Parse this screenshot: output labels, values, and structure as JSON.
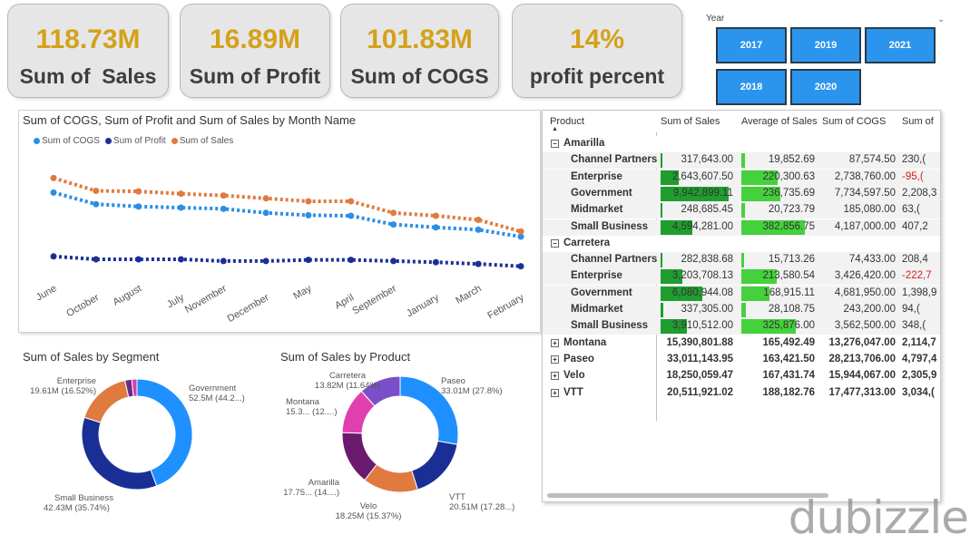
{
  "kpis": [
    {
      "value": "118.73M",
      "label": "Sum of  Sales"
    },
    {
      "value": "16.89M",
      "label": "Sum of Profit"
    },
    {
      "value": "101.83M",
      "label": "Sum of COGS"
    },
    {
      "value": "14%",
      "label": "profit percent"
    }
  ],
  "slicer": {
    "title": "Year",
    "chevron": "chevron-down-icon",
    "years": [
      "2017",
      "2019",
      "2021",
      "2018",
      "2020"
    ]
  },
  "line_chart": {
    "title": "Sum of COGS, Sum of Profit and Sum of Sales by Month Name",
    "legend": [
      "Sum of COGS",
      "Sum of Profit",
      "Sum of  Sales"
    ]
  },
  "segment_chart": {
    "title": "Sum of Sales by Segment",
    "labels": [
      {
        "line1": "Enterprise",
        "line2": "19.61M (16.52%)"
      },
      {
        "line1": "Government",
        "line2": "52.5M (44.2...)"
      },
      {
        "line1": "Small Business",
        "line2": "42.43M (35.74%)"
      }
    ]
  },
  "product_chart": {
    "title": "Sum of Sales by Product",
    "labels": [
      {
        "line1": "Carretera",
        "line2": "13.82M (11.64%)"
      },
      {
        "line1": "Paseo",
        "line2": "33.01M (27.8%)"
      },
      {
        "line1": "Montana",
        "line2": "15.3... (12....)"
      },
      {
        "line1": "Amarilla",
        "line2": "17.75... (14....)"
      },
      {
        "line1": "VTT",
        "line2": "20.51M (17.28...)"
      },
      {
        "line1": "Velo",
        "line2": "18.25M (15.37%)"
      }
    ]
  },
  "table": {
    "headers": [
      "Product",
      "Sum of Sales",
      "Average of Sales",
      "Sum of COGS",
      "Sum of"
    ],
    "rows": [
      {
        "level": 0,
        "expand": "−",
        "label": "Amarilla",
        "cells": [
          "",
          "",
          "",
          ""
        ]
      },
      {
        "level": 1,
        "label": "Channel Partners",
        "cells": [
          "317,643.00",
          "19,852.69",
          "87,574.50",
          "230,("
        ],
        "neg": false
      },
      {
        "level": 1,
        "label": "Enterprise",
        "cells": [
          "2,643,607.50",
          "220,300.63",
          "2,738,760.00",
          "-95,("
        ],
        "neg": true
      },
      {
        "level": 1,
        "label": "Government",
        "cells": [
          "9,942,899.11",
          "236,735.69",
          "7,734,597.50",
          "2,208,3"
        ],
        "neg": false
      },
      {
        "level": 1,
        "label": "Midmarket",
        "cells": [
          "248,685.45",
          "20,723.79",
          "185,080.00",
          "63,("
        ],
        "neg": false
      },
      {
        "level": 1,
        "label": "Small Business",
        "cells": [
          "4,594,281.00",
          "382,856.75",
          "4,187,000.00",
          "407,2"
        ],
        "neg": false
      },
      {
        "level": 0,
        "expand": "−",
        "label": "Carretera",
        "cells": [
          "",
          "",
          "",
          ""
        ]
      },
      {
        "level": 1,
        "label": "Channel Partners",
        "cells": [
          "282,838.68",
          "15,713.26",
          "74,433.00",
          "208,4"
        ],
        "neg": false
      },
      {
        "level": 1,
        "label": "Enterprise",
        "cells": [
          "3,203,708.13",
          "213,580.54",
          "3,426,420.00",
          "-222,7"
        ],
        "neg": true
      },
      {
        "level": 1,
        "label": "Government",
        "cells": [
          "6,080,944.08",
          "168,915.11",
          "4,681,950.00",
          "1,398,9"
        ],
        "neg": false
      },
      {
        "level": 1,
        "label": "Midmarket",
        "cells": [
          "337,305.00",
          "28,108.75",
          "243,200.00",
          "94,("
        ],
        "neg": false
      },
      {
        "level": 1,
        "label": "Small Business",
        "cells": [
          "3,910,512.00",
          "325,876.00",
          "3,562,500.00",
          "348,("
        ],
        "neg": false
      },
      {
        "level": 0,
        "expand": "+",
        "label": "Montana",
        "cells": [
          "15,390,801.88",
          "165,492.49",
          "13,276,047.00",
          "2,114,7"
        ]
      },
      {
        "level": 0,
        "expand": "+",
        "label": "Paseo",
        "cells": [
          "33,011,143.95",
          "163,421.50",
          "28,213,706.00",
          "4,797,4"
        ]
      },
      {
        "level": 0,
        "expand": "+",
        "label": "Velo",
        "cells": [
          "18,250,059.47",
          "167,431.74",
          "15,944,067.00",
          "2,305,9"
        ]
      },
      {
        "level": 0,
        "expand": "+",
        "label": "VTT",
        "cells": [
          "20,511,921.02",
          "188,182.76",
          "17,477,313.00",
          "3,034,("
        ]
      }
    ]
  },
  "watermark": "dubizzle",
  "colors": {
    "kpi_value": "#d4a11a",
    "cogs": "#2b8ee6",
    "profit": "#1a2f96",
    "sales": "#e07a3f",
    "bar_dark": "#1f9e2e",
    "bar_light": "#44d13c",
    "negative": "#d02020",
    "slicer_button": "#2b95ee"
  },
  "chart_data": [
    {
      "type": "line",
      "title": "Sum of COGS, Sum of Profit and Sum of Sales by Month Name",
      "x": [
        "June",
        "October",
        "August",
        "July",
        "November",
        "December",
        "May",
        "April",
        "September",
        "January",
        "March",
        "February"
      ],
      "series": [
        {
          "name": "Sum of COGS",
          "values": [
            14.0,
            12.0,
            11.6,
            11.4,
            11.2,
            10.5,
            10.1,
            10.0,
            8.5,
            8.0,
            7.6,
            6.4
          ]
        },
        {
          "name": "Sum of Profit",
          "values": [
            3.0,
            2.5,
            2.5,
            2.5,
            2.2,
            2.2,
            2.4,
            2.4,
            2.2,
            2.0,
            1.7,
            1.3
          ]
        },
        {
          "name": "Sum of  Sales",
          "values": [
            16.5,
            14.3,
            14.2,
            13.8,
            13.5,
            13.0,
            12.5,
            12.5,
            10.5,
            10.0,
            9.3,
            7.3
          ]
        }
      ],
      "ylim": [
        0,
        20
      ],
      "grid": false,
      "legend_position": "top-left"
    },
    {
      "type": "pie",
      "title": "Sum of Sales by Segment",
      "categories": [
        "Government",
        "Small Business",
        "Enterprise",
        "Midmarket",
        "Channel Partners"
      ],
      "values": [
        52.5,
        42.43,
        19.61,
        2.4,
        1.8
      ],
      "colors": [
        "#1e90ff",
        "#1a2f96",
        "#e07a3f",
        "#6b2a8a",
        "#d93fa8"
      ]
    },
    {
      "type": "pie",
      "title": "Sum of Sales by Product",
      "categories": [
        "Paseo",
        "VTT",
        "Velo",
        "Amarilla",
        "Montana",
        "Carretera"
      ],
      "values": [
        33.01,
        20.51,
        18.25,
        17.75,
        15.3,
        13.82
      ],
      "colors": [
        "#1e90ff",
        "#1a2f96",
        "#e07a3f",
        "#6b1a6e",
        "#e03fb0",
        "#7a4fc9"
      ]
    }
  ]
}
